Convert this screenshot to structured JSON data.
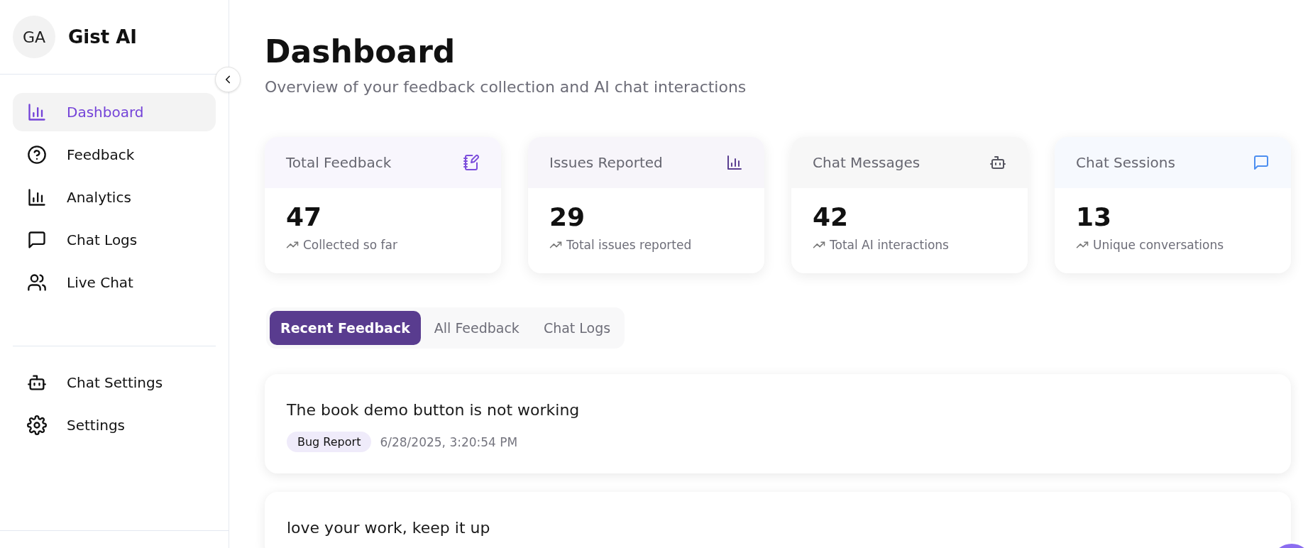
{
  "brand": {
    "initials": "GA",
    "name": "Gist AI"
  },
  "nav": [
    {
      "label": "Dashboard",
      "kind": "bars",
      "selected": true
    },
    {
      "label": "Feedback",
      "kind": "help",
      "selected": false
    },
    {
      "label": "Analytics",
      "kind": "bars",
      "selected": false
    },
    {
      "label": "Chat Logs",
      "kind": "message",
      "selected": false
    },
    {
      "label": "Live Chat",
      "kind": "users",
      "selected": false
    }
  ],
  "nav_secondary": [
    {
      "label": "Chat Settings",
      "kind": "bot",
      "selected": false
    },
    {
      "label": "Settings",
      "kind": "gear",
      "selected": false
    }
  ],
  "header": {
    "title": "Dashboard",
    "subtitle": "Overview of your feedback collection and AI chat interactions"
  },
  "stats": [
    {
      "label": "Total Feedback",
      "value": "47",
      "note": "Collected so far",
      "kind": "notebook",
      "color": "#7c4ddb"
    },
    {
      "label": "Issues Reported",
      "value": "29",
      "note": "Total issues reported",
      "kind": "bars",
      "color": "#5b3f91"
    },
    {
      "label": "Chat Messages",
      "value": "42",
      "note": "Total AI interactions",
      "kind": "bot",
      "color": "#555560"
    },
    {
      "label": "Chat Sessions",
      "value": "13",
      "note": "Unique conversations",
      "kind": "message",
      "color": "#4d8ff0"
    }
  ],
  "tabs": [
    {
      "label": "Recent Feedback",
      "selected": true
    },
    {
      "label": "All Feedback",
      "selected": false
    },
    {
      "label": "Chat Logs",
      "selected": false
    }
  ],
  "feedback": [
    {
      "text": "The book demo button is not working",
      "category": "Bug Report",
      "time": "6/28/2025, 3:20:54 PM"
    },
    {
      "text": "love your work, keep it up"
    }
  ]
}
